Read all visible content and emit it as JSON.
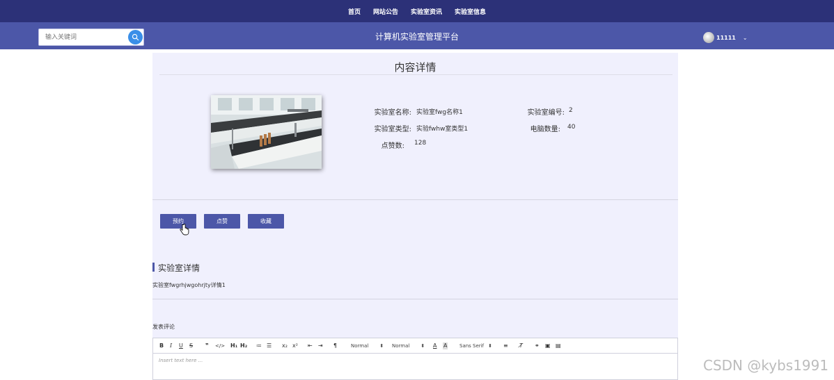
{
  "nav": {
    "items": [
      {
        "label": "首页"
      },
      {
        "label": "网站公告"
      },
      {
        "label": "实验室资讯"
      },
      {
        "label": "实验室信息"
      }
    ],
    "color": "#2c3178"
  },
  "header": {
    "search_placeholder": "输入关键词",
    "site_title": "计算机实验室管理平台",
    "username": "11111",
    "color": "#4c57a8"
  },
  "detail": {
    "page_title": "内容详情",
    "fields": {
      "name_label": "实验室名称:",
      "name_value": "实验室fwg名称1",
      "number_label": "实验室编号:",
      "number_value": "2",
      "type_label": "实验室类型:",
      "type_value": "实验fwhw室类型1",
      "computers_label": "电脑数量:",
      "computers_value": "40",
      "likes_label": "点赞数:",
      "likes_value": "128"
    },
    "buttons": {
      "reserve": "预约",
      "like": "点赞",
      "favorite": "收藏"
    },
    "section_title": "实验室详情",
    "description": "实验室fwgrhjwgohrjty详情1",
    "comment_label": "发表评论"
  },
  "editor": {
    "header_select": "Normal",
    "size_select": "Normal",
    "font_select": "Sans Serif",
    "placeholder": "Insert text here ..."
  },
  "watermark": "CSDN @kybs1991"
}
